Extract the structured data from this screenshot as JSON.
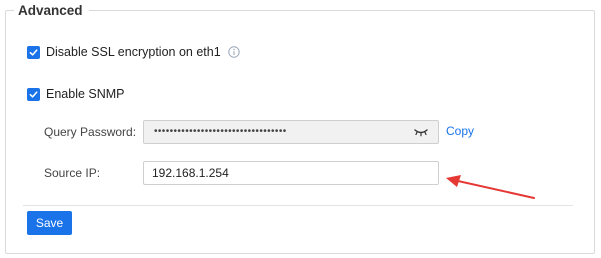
{
  "section": {
    "title": "Advanced"
  },
  "ssl": {
    "label": "Disable SSL encryption on eth1",
    "checked": true
  },
  "snmp": {
    "label": "Enable SNMP",
    "checked": true
  },
  "query_password": {
    "label": "Query Password:",
    "masked_value": "••••••••••••••••••••••••••••••••••",
    "copy_label": "Copy"
  },
  "source_ip": {
    "label": "Source IP:",
    "value": "192.168.1.254"
  },
  "actions": {
    "save_label": "Save"
  },
  "colors": {
    "accent": "#1a73e8",
    "annotation_arrow": "#e53935"
  },
  "icons": {
    "checkbox": "checkmark-icon",
    "info": "info-icon",
    "password_visibility": "eye-closed-icon",
    "annotation": "arrow-annotation"
  }
}
